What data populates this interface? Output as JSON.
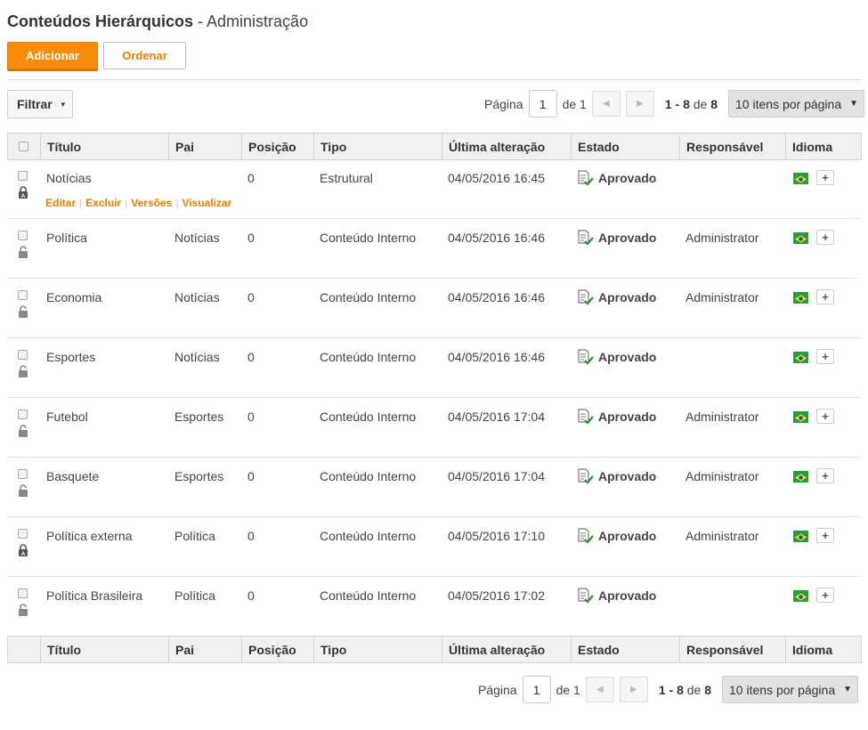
{
  "header": {
    "title_main": "Conteúdos Hierárquicos",
    "title_rest": " - Administração"
  },
  "toolbar": {
    "add_label": "Adicionar",
    "order_label": "Ordenar",
    "filter_label": "Filtrar"
  },
  "pager": {
    "page_label": "Página",
    "page_value": "1",
    "of_label": "de 1",
    "range": "1 - 8",
    "range_of": "de",
    "total": "8",
    "per_page": "10 itens por página"
  },
  "columns": [
    "Título",
    "Pai",
    "Posição",
    "Tipo",
    "Última alteração",
    "Estado",
    "Responsável",
    "Idioma"
  ],
  "row_actions": [
    "Editar",
    "Excluir",
    "Versões",
    "Visualizar"
  ],
  "rows": [
    {
      "titulo": "Notícias",
      "pai": "",
      "posicao": "0",
      "tipo": "Estrutural",
      "alteracao": "04/05/2016 16:45",
      "estado": "Aprovado",
      "responsavel": "",
      "locked": true
    },
    {
      "titulo": "Política",
      "pai": "Notícias",
      "posicao": "0",
      "tipo": "Conteúdo Interno",
      "alteracao": "04/05/2016 16:46",
      "estado": "Aprovado",
      "responsavel": "Administrator",
      "locked": false
    },
    {
      "titulo": "Economia",
      "pai": "Notícias",
      "posicao": "0",
      "tipo": "Conteúdo Interno",
      "alteracao": "04/05/2016 16:46",
      "estado": "Aprovado",
      "responsavel": "Administrator",
      "locked": false
    },
    {
      "titulo": "Esportes",
      "pai": "Notícias",
      "posicao": "0",
      "tipo": "Conteúdo Interno",
      "alteracao": "04/05/2016 16:46",
      "estado": "Aprovado",
      "responsavel": "",
      "locked": false
    },
    {
      "titulo": "Futebol",
      "pai": "Esportes",
      "posicao": "0",
      "tipo": "Conteúdo Interno",
      "alteracao": "04/05/2016 17:04",
      "estado": "Aprovado",
      "responsavel": "Administrator",
      "locked": false
    },
    {
      "titulo": "Basquete",
      "pai": "Esportes",
      "posicao": "0",
      "tipo": "Conteúdo Interno",
      "alteracao": "04/05/2016 17:04",
      "estado": "Aprovado",
      "responsavel": "Administrator",
      "locked": false
    },
    {
      "titulo": "Política externa",
      "pai": "Política",
      "posicao": "0",
      "tipo": "Conteúdo Interno",
      "alteracao": "04/05/2016 17:10",
      "estado": "Aprovado",
      "responsavel": "Administrator",
      "locked": true
    },
    {
      "titulo": "Política Brasileira",
      "pai": "Política",
      "posicao": "0",
      "tipo": "Conteúdo Interno",
      "alteracao": "04/05/2016 17:02",
      "estado": "Aprovado",
      "responsavel": "",
      "locked": false
    }
  ],
  "colors": {
    "accent": "#f98c0b",
    "approved": "#3a9d3a"
  },
  "icons": {
    "estado": "approved-document-icon",
    "lock": "lock-icon",
    "flag": "brazil-flag-icon",
    "add_language": "plus-icon"
  }
}
